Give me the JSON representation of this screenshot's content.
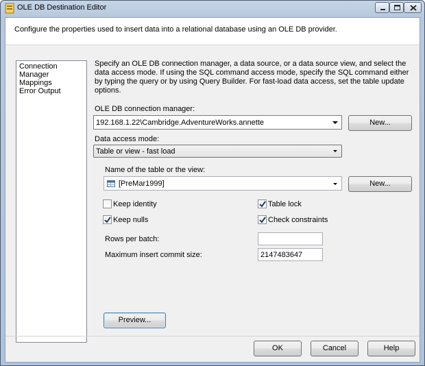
{
  "window": {
    "title": "OLE DB Destination Editor"
  },
  "header": {
    "text": "Configure the properties used to insert data into a relational database using an OLE DB provider."
  },
  "nav": {
    "items": [
      {
        "label": "Connection Manager"
      },
      {
        "label": "Mappings"
      },
      {
        "label": "Error Output"
      }
    ]
  },
  "main": {
    "description": "Specify an OLE DB connection manager, a data source, or a data source view, and select the data access mode. If using the SQL command access mode, specify the SQL command either by typing the query or by using Query Builder. For fast-load data access, set the table update options.",
    "connection_label": "OLE DB connection manager:",
    "connection_value": "192.168.1.22\\Cambridge.AdventureWorks.annette",
    "new_button_1": "New...",
    "access_mode_label": "Data access mode:",
    "access_mode_value": "Table or view - fast load",
    "table_label": "Name of the table or the view:",
    "table_value": "[PreMar1999]",
    "new_button_2": "New...",
    "options": {
      "keep_identity": {
        "label": "Keep identity",
        "checked": false
      },
      "keep_nulls": {
        "label": "Keep nulls",
        "checked": true
      },
      "table_lock": {
        "label": "Table lock",
        "checked": true
      },
      "check_constraints": {
        "label": "Check constraints",
        "checked": true
      }
    },
    "rows_per_batch_label": "Rows per batch:",
    "rows_per_batch_value": "",
    "max_commit_label": "Maximum insert commit size:",
    "max_commit_value": "2147483647",
    "preview_button": "Preview..."
  },
  "footer": {
    "ok": "OK",
    "cancel": "Cancel",
    "help": "Help"
  }
}
